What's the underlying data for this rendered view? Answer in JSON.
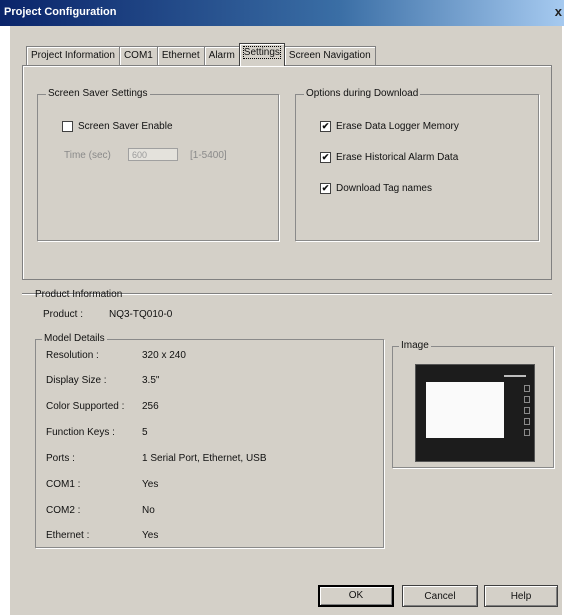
{
  "window": {
    "title": "Project Configuration",
    "close_glyph": "x"
  },
  "tabs": [
    {
      "label": "Project Information"
    },
    {
      "label": "COM1"
    },
    {
      "label": "Ethernet"
    },
    {
      "label": "Alarm"
    },
    {
      "label": "Settings",
      "active": true
    },
    {
      "label": "Screen Navigation"
    }
  ],
  "screen_saver": {
    "group_label": "Screen Saver Settings",
    "enable_label": "Screen Saver Enable",
    "enabled": false,
    "time_label": "Time (sec)",
    "time_value": "600",
    "time_range": "[1-5400]"
  },
  "download_options": {
    "group_label": "Options during Download",
    "items": [
      {
        "label": "Erase Data Logger Memory",
        "checked": true,
        "mark": "✔"
      },
      {
        "label": "Erase Historical Alarm Data",
        "checked": true,
        "mark": "✔"
      },
      {
        "label": "Download Tag names",
        "checked": true,
        "mark": "✔"
      }
    ]
  },
  "product_info": {
    "group_label": "Product Information",
    "product_label": "Product :",
    "product_value": "NQ3-TQ010-0",
    "model_details": {
      "group_label": "Model Details",
      "rows": [
        {
          "label": "Resolution :",
          "value": "320 x 240"
        },
        {
          "label": "Display Size :",
          "value": "3.5\""
        },
        {
          "label": "Color Supported :",
          "value": "256"
        },
        {
          "label": "Function Keys :",
          "value": "5"
        },
        {
          "label": "Ports :",
          "value": "1 Serial Port, Ethernet, USB"
        },
        {
          "label": "COM1 :",
          "value": "Yes"
        },
        {
          "label": "COM2 :",
          "value": "No"
        },
        {
          "label": "Ethernet :",
          "value": "Yes"
        }
      ]
    },
    "image_group_label": "Image"
  },
  "buttons": {
    "ok": "OK",
    "cancel": "Cancel",
    "help": "Help"
  },
  "colors": {
    "dialog_bg": "#d4d0c8",
    "title_start": "#0a246a",
    "title_end": "#a6caf0"
  }
}
